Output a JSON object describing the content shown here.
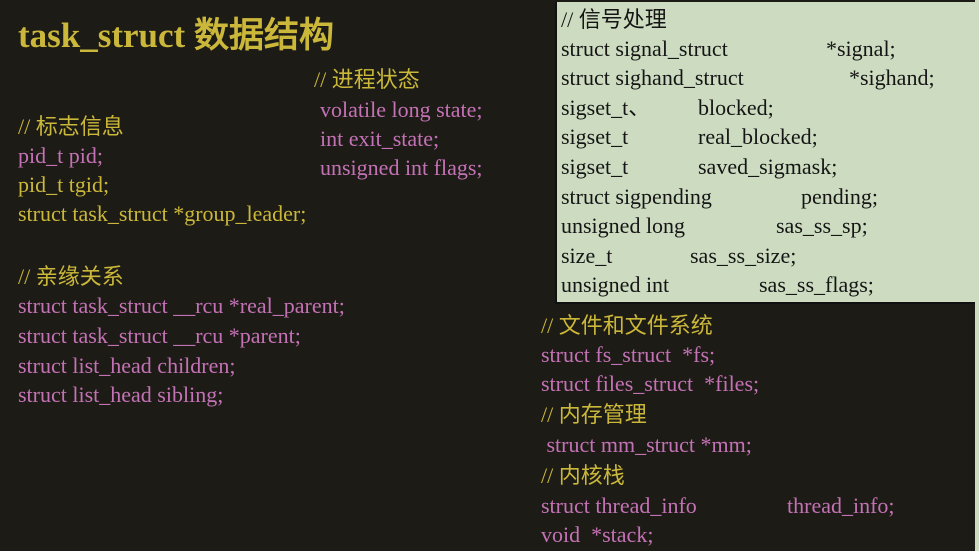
{
  "title": "task_struct 数据结构",
  "colors": {
    "background": "#1d1b15",
    "comment": "#cbb83a",
    "code": "#c472b6",
    "box": "#cddcc1"
  },
  "identity": {
    "comment": "// 标志信息",
    "lines": [
      "pid_t pid;",
      "pid_t tgid;",
      "struct task_struct *group_leader;"
    ]
  },
  "state": {
    "comment": "// 进程状态",
    "lines": [
      "volatile long state;",
      "int exit_state;",
      "unsigned int flags;"
    ]
  },
  "relations": {
    "comment": "// 亲缘关系",
    "lines": [
      "struct task_struct __rcu *real_parent;",
      "struct task_struct __rcu *parent;",
      "struct list_head children;",
      "struct list_head sibling;"
    ]
  },
  "signals": {
    "comment": "// 信号处理",
    "rows": [
      {
        "type": "struct signal_struct",
        "name": "*signal;"
      },
      {
        "type": "struct sighand_struct",
        "name": "*sighand;"
      },
      {
        "type": "sigset_t、",
        "name": "blocked;"
      },
      {
        "type": "sigset_t",
        "name": "real_blocked;"
      },
      {
        "type": "sigset_t",
        "name": "saved_sigmask;"
      },
      {
        "type": "struct sigpending",
        "name": "pending;"
      },
      {
        "type": "unsigned long",
        "name": "sas_ss_sp;"
      },
      {
        "type": "size_t",
        "name": "sas_ss_size;"
      },
      {
        "type": "unsigned int",
        "name": "sas_ss_flags;"
      }
    ]
  },
  "files": {
    "comment": "// 文件和文件系统",
    "lines": [
      "struct fs_struct  *fs;",
      "struct files_struct  *files;"
    ]
  },
  "memory": {
    "comment": "// 内存管理",
    "lines": [
      " struct mm_struct *mm;"
    ]
  },
  "kstack": {
    "comment": "// 内核栈",
    "row": {
      "type": "struct thread_info",
      "name": "thread_info;"
    },
    "lines": [
      "void  *stack;"
    ]
  }
}
